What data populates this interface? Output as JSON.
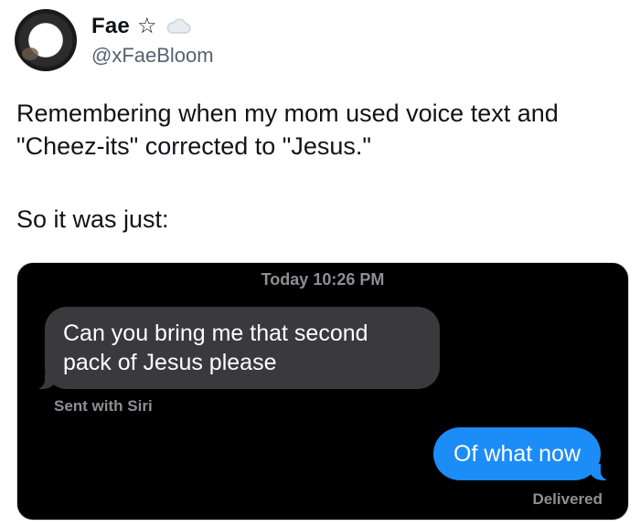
{
  "author": {
    "display_name": "Fae",
    "star_glyph": "☆",
    "handle": "@xFaeBloom"
  },
  "tweet": {
    "line1": "Remembering when my mom used voice text and",
    "line2": "\"Cheez-its\" corrected to \"Jesus.\"",
    "line3": "So it was just:"
  },
  "screenshot": {
    "timestamp": "Today 10:26 PM",
    "incoming_message": "Can you bring me that second pack of Jesus please",
    "incoming_footer": "Sent with Siri",
    "outgoing_message": "Of what now",
    "outgoing_status": "Delivered"
  },
  "colors": {
    "incoming_bubble": "#3a3a3c",
    "outgoing_bubble": "#1c8cf7",
    "handle_gray": "#536471"
  },
  "icons": [
    "star-icon",
    "cloud-icon"
  ]
}
